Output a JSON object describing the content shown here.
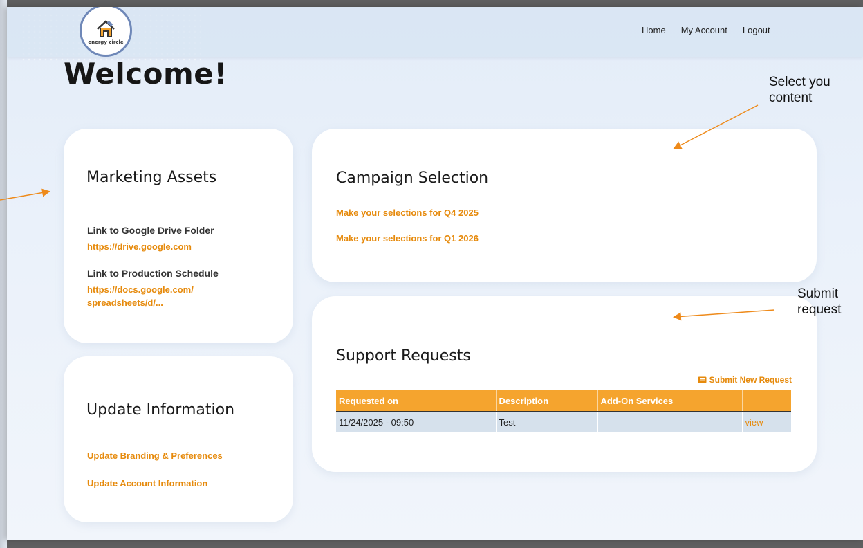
{
  "header": {
    "logo_text": "energy circle",
    "nav": [
      "Home",
      "My Account",
      "Logout"
    ]
  },
  "welcome": "Welcome!",
  "marketing_assets": {
    "title": "Marketing Assets",
    "drive_label": "Link to Google Drive Folder",
    "drive_link": "https://drive.google.com",
    "schedule_label": "Link to Production Schedule",
    "schedule_link_line1": "https://docs.google.com/",
    "schedule_link_line2": "spreadsheets/d/..."
  },
  "update_information": {
    "title": "Update Information",
    "links": [
      "Update Branding & Preferences",
      "Update Account Information"
    ]
  },
  "campaign_selection": {
    "title": "Campaign Selection",
    "links": [
      "Make your selections for Q4 2025",
      "Make your selections for Q1 2026"
    ]
  },
  "support_requests": {
    "title": "Support Requests",
    "submit_new": "Submit New Request",
    "columns": [
      "Requested on",
      "Description",
      "Add-On Services",
      ""
    ],
    "rows": [
      {
        "requested_on": "11/24/2025 - 09:50",
        "description": "Test",
        "addon": "",
        "action": "view"
      }
    ]
  },
  "annotations": {
    "select_line1": "Select you",
    "select_line2": "content",
    "submit_line1": "Submit",
    "submit_line2": "request"
  },
  "colors": {
    "accent": "#e68a0c",
    "table_header": "#f5a42e",
    "annotation_arrow": "#ee8a1a"
  }
}
